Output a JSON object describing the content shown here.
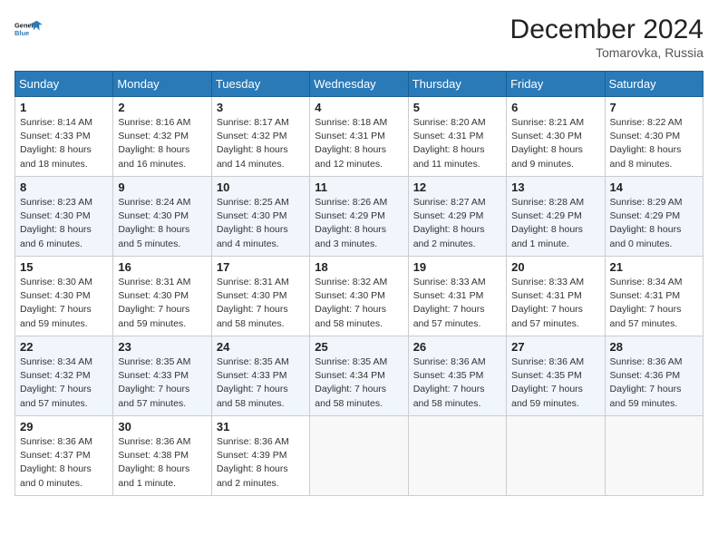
{
  "header": {
    "logo_line1": "General",
    "logo_line2": "Blue",
    "month": "December 2024",
    "location": "Tomarovka, Russia"
  },
  "days_of_week": [
    "Sunday",
    "Monday",
    "Tuesday",
    "Wednesday",
    "Thursday",
    "Friday",
    "Saturday"
  ],
  "weeks": [
    [
      {
        "day": "1",
        "info": "Sunrise: 8:14 AM\nSunset: 4:33 PM\nDaylight: 8 hours and 18 minutes."
      },
      {
        "day": "2",
        "info": "Sunrise: 8:16 AM\nSunset: 4:32 PM\nDaylight: 8 hours and 16 minutes."
      },
      {
        "day": "3",
        "info": "Sunrise: 8:17 AM\nSunset: 4:32 PM\nDaylight: 8 hours and 14 minutes."
      },
      {
        "day": "4",
        "info": "Sunrise: 8:18 AM\nSunset: 4:31 PM\nDaylight: 8 hours and 12 minutes."
      },
      {
        "day": "5",
        "info": "Sunrise: 8:20 AM\nSunset: 4:31 PM\nDaylight: 8 hours and 11 minutes."
      },
      {
        "day": "6",
        "info": "Sunrise: 8:21 AM\nSunset: 4:30 PM\nDaylight: 8 hours and 9 minutes."
      },
      {
        "day": "7",
        "info": "Sunrise: 8:22 AM\nSunset: 4:30 PM\nDaylight: 8 hours and 8 minutes."
      }
    ],
    [
      {
        "day": "8",
        "info": "Sunrise: 8:23 AM\nSunset: 4:30 PM\nDaylight: 8 hours and 6 minutes."
      },
      {
        "day": "9",
        "info": "Sunrise: 8:24 AM\nSunset: 4:30 PM\nDaylight: 8 hours and 5 minutes."
      },
      {
        "day": "10",
        "info": "Sunrise: 8:25 AM\nSunset: 4:30 PM\nDaylight: 8 hours and 4 minutes."
      },
      {
        "day": "11",
        "info": "Sunrise: 8:26 AM\nSunset: 4:29 PM\nDaylight: 8 hours and 3 minutes."
      },
      {
        "day": "12",
        "info": "Sunrise: 8:27 AM\nSunset: 4:29 PM\nDaylight: 8 hours and 2 minutes."
      },
      {
        "day": "13",
        "info": "Sunrise: 8:28 AM\nSunset: 4:29 PM\nDaylight: 8 hours and 1 minute."
      },
      {
        "day": "14",
        "info": "Sunrise: 8:29 AM\nSunset: 4:29 PM\nDaylight: 8 hours and 0 minutes."
      }
    ],
    [
      {
        "day": "15",
        "info": "Sunrise: 8:30 AM\nSunset: 4:30 PM\nDaylight: 7 hours and 59 minutes."
      },
      {
        "day": "16",
        "info": "Sunrise: 8:31 AM\nSunset: 4:30 PM\nDaylight: 7 hours and 59 minutes."
      },
      {
        "day": "17",
        "info": "Sunrise: 8:31 AM\nSunset: 4:30 PM\nDaylight: 7 hours and 58 minutes."
      },
      {
        "day": "18",
        "info": "Sunrise: 8:32 AM\nSunset: 4:30 PM\nDaylight: 7 hours and 58 minutes."
      },
      {
        "day": "19",
        "info": "Sunrise: 8:33 AM\nSunset: 4:31 PM\nDaylight: 7 hours and 57 minutes."
      },
      {
        "day": "20",
        "info": "Sunrise: 8:33 AM\nSunset: 4:31 PM\nDaylight: 7 hours and 57 minutes."
      },
      {
        "day": "21",
        "info": "Sunrise: 8:34 AM\nSunset: 4:31 PM\nDaylight: 7 hours and 57 minutes."
      }
    ],
    [
      {
        "day": "22",
        "info": "Sunrise: 8:34 AM\nSunset: 4:32 PM\nDaylight: 7 hours and 57 minutes."
      },
      {
        "day": "23",
        "info": "Sunrise: 8:35 AM\nSunset: 4:33 PM\nDaylight: 7 hours and 57 minutes."
      },
      {
        "day": "24",
        "info": "Sunrise: 8:35 AM\nSunset: 4:33 PM\nDaylight: 7 hours and 58 minutes."
      },
      {
        "day": "25",
        "info": "Sunrise: 8:35 AM\nSunset: 4:34 PM\nDaylight: 7 hours and 58 minutes."
      },
      {
        "day": "26",
        "info": "Sunrise: 8:36 AM\nSunset: 4:35 PM\nDaylight: 7 hours and 58 minutes."
      },
      {
        "day": "27",
        "info": "Sunrise: 8:36 AM\nSunset: 4:35 PM\nDaylight: 7 hours and 59 minutes."
      },
      {
        "day": "28",
        "info": "Sunrise: 8:36 AM\nSunset: 4:36 PM\nDaylight: 7 hours and 59 minutes."
      }
    ],
    [
      {
        "day": "29",
        "info": "Sunrise: 8:36 AM\nSunset: 4:37 PM\nDaylight: 8 hours and 0 minutes."
      },
      {
        "day": "30",
        "info": "Sunrise: 8:36 AM\nSunset: 4:38 PM\nDaylight: 8 hours and 1 minute."
      },
      {
        "day": "31",
        "info": "Sunrise: 8:36 AM\nSunset: 4:39 PM\nDaylight: 8 hours and 2 minutes."
      },
      null,
      null,
      null,
      null
    ]
  ]
}
